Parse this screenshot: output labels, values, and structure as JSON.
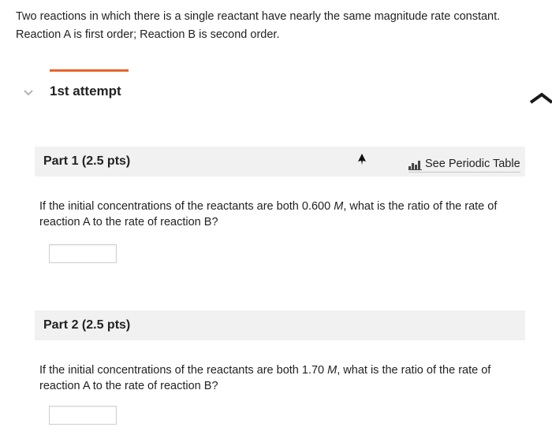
{
  "intro_text": "Two reactions in which there is a single reactant have nearly the same magnitude rate constant. Reaction A is first order; Reaction B is second order.",
  "attempt": {
    "label": "1st attempt"
  },
  "part1": {
    "title": "Part 1 (2.5 pts)",
    "periodic_link": "See Periodic Table",
    "question_before": "If the initial concentrations of the reactants are both 0.600 ",
    "unit": "M",
    "question_after": ", what is the ratio of the rate of reaction A to the rate of reaction B?",
    "answer_value": ""
  },
  "part2": {
    "title": "Part 2 (2.5 pts)",
    "question_before": "If the initial concentrations of the reactants are both 1.70 ",
    "unit": "M",
    "question_after": ", what is the ratio of the rate of reaction A to the rate of reaction B?",
    "answer_value": ""
  },
  "colors": {
    "accent": "#e8642c",
    "header_bg": "#f1f1f1"
  },
  "icons": [
    "chevron-down-icon",
    "expand-arrow-icon",
    "periodic-table-icon",
    "mouse-cursor-icon"
  ]
}
